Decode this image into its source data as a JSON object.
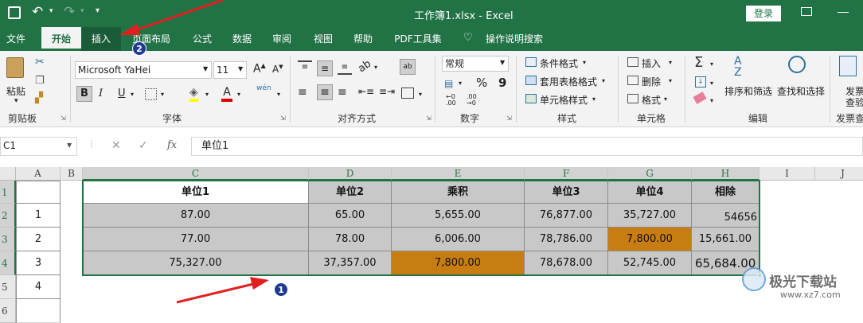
{
  "title_bar": {
    "title": "工作簿1.xlsx - Excel",
    "login_label": "登录"
  },
  "tabs": [
    "文件",
    "开始",
    "插入",
    "页面布局",
    "公式",
    "数据",
    "审阅",
    "视图",
    "帮助",
    "PDF工具集",
    "操作说明搜索"
  ],
  "active_tab": "开始",
  "clipboard": {
    "paste_label": "粘贴",
    "group_label": "剪贴板"
  },
  "font": {
    "name": "Microsoft YaHei",
    "size": "11",
    "group_label": "字体",
    "bold": "B",
    "italic": "I",
    "underline": "U",
    "phonetic": "wén"
  },
  "alignment": {
    "group_label": "对齐方式"
  },
  "number": {
    "format": "常规",
    "percent": "%",
    "comma": "9",
    "group_label": "数字"
  },
  "styles": {
    "conditional": "条件格式",
    "table_format": "套用表格格式",
    "cell_styles": "单元格样式",
    "group_label": "样式"
  },
  "cells": {
    "insert": "插入",
    "delete": "删除",
    "format": "格式",
    "group_label": "单元格"
  },
  "editing": {
    "sort_filter": "排序和筛选",
    "find_select": "查找和选择",
    "group_label": "编辑"
  },
  "extra": {
    "line1": "发票",
    "line2": "查验",
    "group_label": "发票查"
  },
  "formula": {
    "name_box": "C1",
    "fx": "fx",
    "content": "单位1"
  },
  "columns": [
    "A",
    "B",
    "C",
    "D",
    "E",
    "F",
    "G",
    "H",
    "I",
    "J"
  ],
  "rows": [
    "1",
    "2",
    "3",
    "4",
    "5",
    "6"
  ],
  "table": {
    "headers": [
      "单位1",
      "单位2",
      "乘积",
      "单位3",
      "单位4",
      "相除"
    ],
    "a_values": [
      "1",
      "2",
      "3",
      "4"
    ],
    "data": [
      [
        "87.00",
        "65.00",
        "5,655.00",
        "76,877.00",
        "35,727.00",
        "54656"
      ],
      [
        "77.00",
        "78.00",
        "6,006.00",
        "78,786.00",
        "7,800.00",
        "15,661.00"
      ],
      [
        "75,327.00",
        "37,357.00",
        "7,800.00",
        "78,678.00",
        "52,745.00",
        "65,684.00"
      ]
    ]
  },
  "annotations": {
    "badge1": "1",
    "badge2": "2"
  },
  "watermark": {
    "text": "极光下载站",
    "url": "www.xz7.com"
  },
  "colors": {
    "excel_green": "#217346",
    "highlight": "#c87d12",
    "gray_fill": "#c8c8c8",
    "arrow": "#e02020",
    "badge": "#1f3a93"
  }
}
